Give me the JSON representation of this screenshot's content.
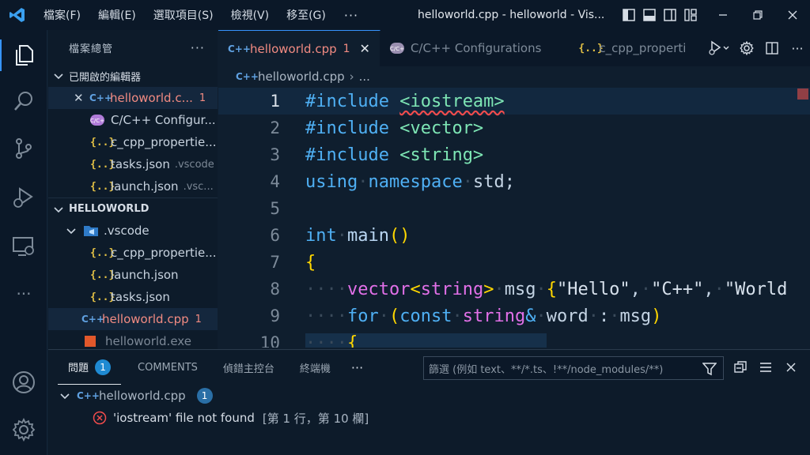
{
  "menu": {
    "items": [
      "檔案(F)",
      "編輯(E)",
      "選取項目(S)",
      "檢視(V)",
      "移至(G)"
    ],
    "more": "···"
  },
  "window_title": "helloworld.cpp - helloworld - Vis...",
  "sidebar": {
    "title": "檔案總管",
    "more": "···",
    "open_editors_label": "已開啟的編輯器",
    "open_editors": [
      {
        "icon": "cpp-icon",
        "name": "helloworld.c...",
        "badge": "1"
      },
      {
        "icon": "settings-file-icon",
        "name": "C/C++ Configur..."
      },
      {
        "icon": "json-icon",
        "name": "c_cpp_propertie..."
      },
      {
        "icon": "json-icon",
        "name": "tasks.json",
        "folder": ".vscode"
      },
      {
        "icon": "json-icon",
        "name": "launch.json",
        "folder": ".vsc..."
      }
    ],
    "project_label": "HELLOWORLD",
    "folder": ".vscode",
    "folder_files": [
      "c_cpp_propertie...",
      "launch.json",
      "tasks.json"
    ],
    "active_file": {
      "name": "helloworld.cpp",
      "badge": "1"
    },
    "cut_file": "helloworld.exe"
  },
  "tabs": [
    {
      "label": "helloworld.cpp",
      "badge": "1",
      "active": true
    },
    {
      "label": "C/C++ Configurations",
      "active": false
    },
    {
      "label": "c_cpp_properti",
      "active": false
    }
  ],
  "breadcrumb": {
    "file": "helloworld.cpp",
    "rest": "..."
  },
  "code_lines": [
    {
      "n": "1",
      "text": "#include <iostream>"
    },
    {
      "n": "2",
      "text": "#include <vector>"
    },
    {
      "n": "3",
      "text": "#include <string>"
    },
    {
      "n": "4",
      "text": "using namespace std;"
    },
    {
      "n": "5",
      "text": ""
    },
    {
      "n": "6",
      "text": "int main()"
    },
    {
      "n": "7",
      "text": "{"
    },
    {
      "n": "8",
      "text": "    vector<string> msg {\"Hello\", \"C++\", \"World"
    },
    {
      "n": "9",
      "text": "    for (const string& word : msg)"
    },
    {
      "n": "10",
      "text": "    {"
    }
  ],
  "panel": {
    "tabs": [
      {
        "label": "問題",
        "badge": "1",
        "active": true
      },
      {
        "label": "COMMENTS"
      },
      {
        "label": "偵錯主控台"
      },
      {
        "label": "終端機"
      }
    ],
    "more": "···",
    "filter_placeholder": "篩選 (例如 text、**/*.ts、!**/node_modules/**)",
    "problem_file": "helloworld.cpp",
    "problem_count": "1",
    "problem_message": "'iostream' file not found",
    "problem_location": "[第 1 行，第 10 欄]"
  },
  "colors": {
    "accent": "#3794ff",
    "error": "#f28b82",
    "keyword": "#4fb0f4",
    "type": "#e270e8",
    "bracket": "#ffd700"
  }
}
